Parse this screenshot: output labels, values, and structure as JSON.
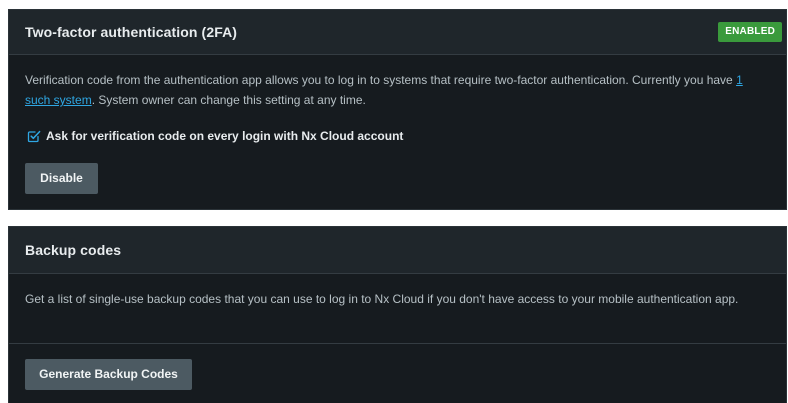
{
  "two_factor": {
    "title": "Two-factor authentication (2FA)",
    "badge": "ENABLED",
    "badge_color": "#3a9a3c",
    "description_before": "Verification code from the authentication app allows you to log in to systems that require two-factor authentication. Currently you have ",
    "description_link": "1 such system",
    "description_after": ". System owner can change this setting at any time.",
    "checkbox_label": "Ask for verification code on every login with Nx Cloud account",
    "checkbox_checked": true,
    "disable_button": "Disable"
  },
  "backup_codes": {
    "title": "Backup codes",
    "description": "Get a list of single-use backup codes that you can use to log in to Nx Cloud if you don't have access to your mobile authentication app.",
    "generate_button": "Generate Backup Codes"
  },
  "colors": {
    "panel_background": "#161b1f",
    "header_background": "#1f262b",
    "link": "#2fa7e3",
    "button": "#4c5a62"
  }
}
